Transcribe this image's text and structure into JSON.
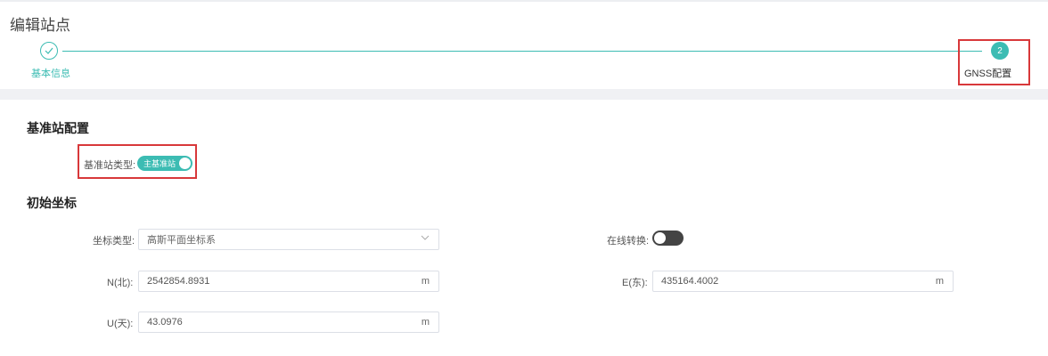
{
  "page_title": "编辑站点",
  "steps": [
    {
      "number": "",
      "label": "基本信息",
      "status": "done"
    },
    {
      "number": "2",
      "label": "GNSS配置",
      "status": "active"
    }
  ],
  "colors": {
    "accent": "#3cbcb3",
    "highlight": "#d8383a"
  },
  "base_station": {
    "section_title": "基准站配置",
    "type_label": "基准站类型:",
    "type_value": "主基准站",
    "type_on": true
  },
  "initial_coords": {
    "section_title": "初始坐标",
    "coord_type_label": "坐标类型:",
    "coord_type_value": "高斯平面坐标系",
    "online_label": "在线转换:",
    "online_on": false,
    "n_label": "N(北):",
    "n_value": "2542854.8931",
    "n_unit": "m",
    "e_label": "E(东):",
    "e_value": "435164.4002",
    "e_unit": "m",
    "u_label": "U(天):",
    "u_value": "43.0976",
    "u_unit": "m"
  }
}
